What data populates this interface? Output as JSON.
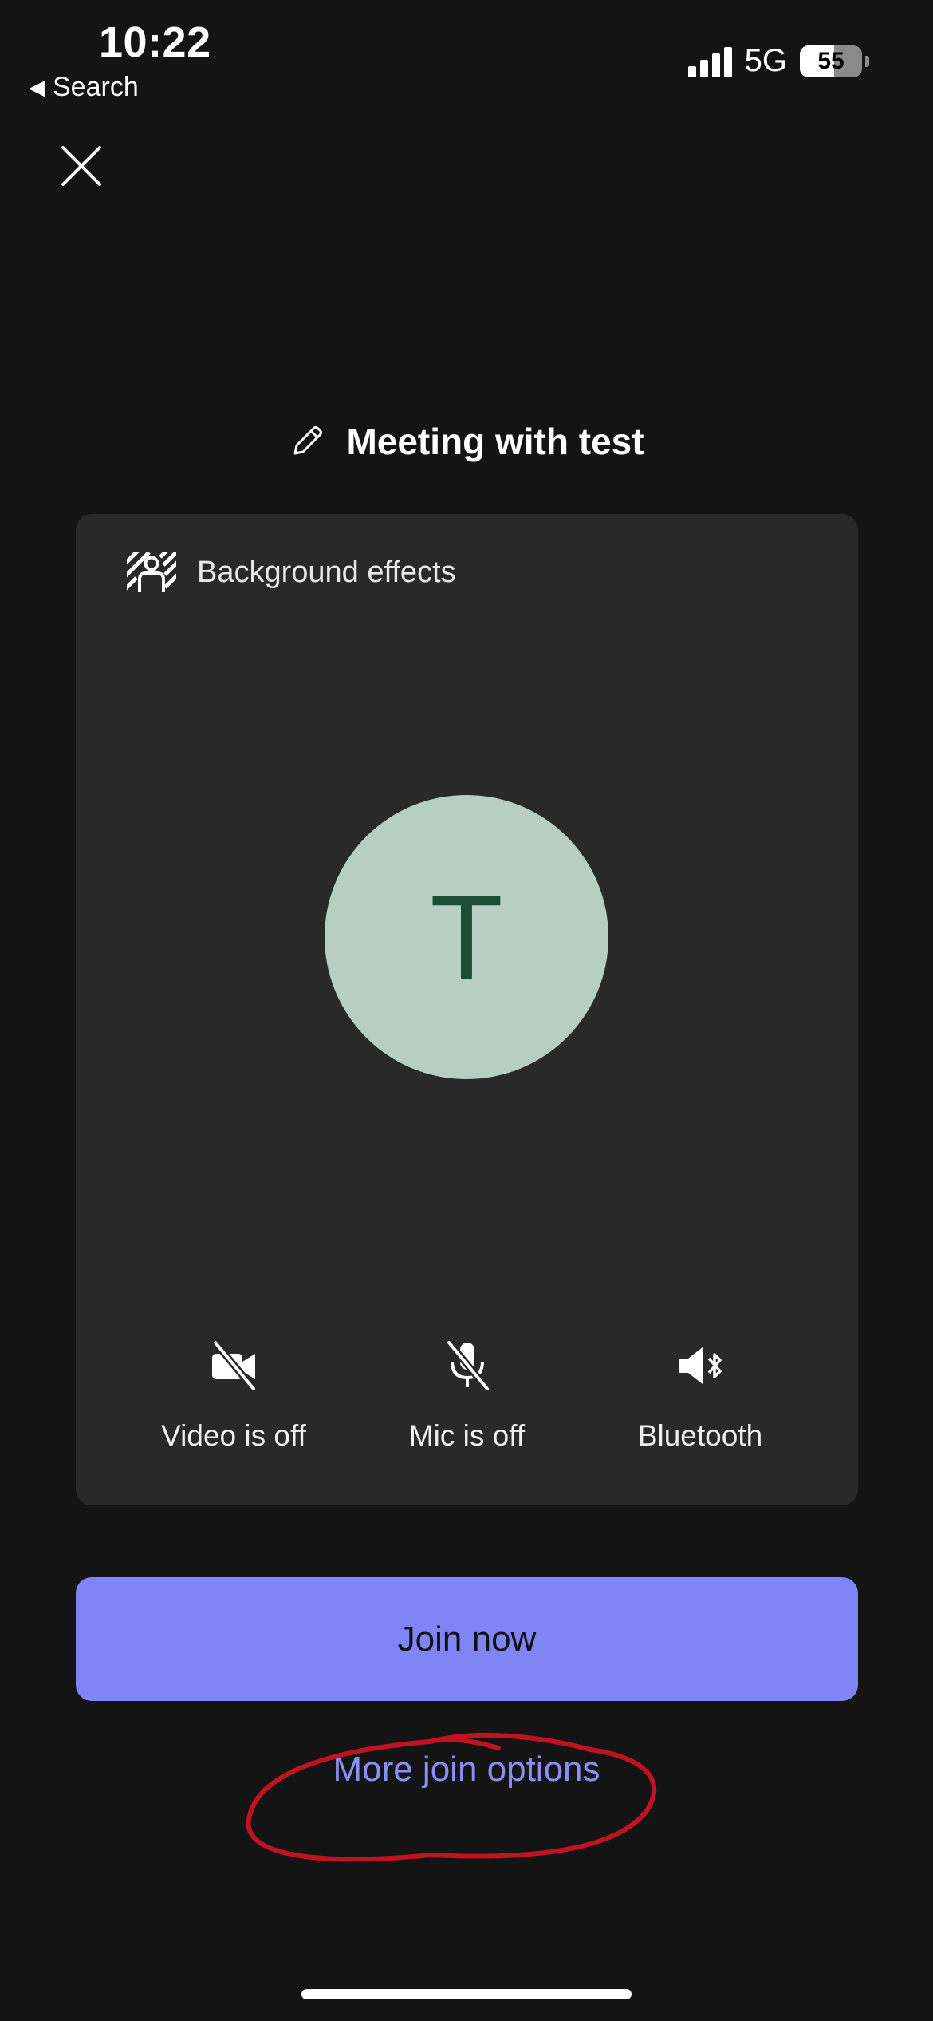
{
  "status_bar": {
    "time": "10:22",
    "back_label": "Search",
    "network": "5G",
    "battery_percent": "55",
    "battery_level": 0.55
  },
  "meeting": {
    "title": "Meeting with test"
  },
  "preview": {
    "background_effects_label": "Background effects",
    "avatar_initial": "T",
    "avatar_color": "#b7cfc3",
    "avatar_text_color": "#1e4d35",
    "controls": [
      {
        "icon": "video-off-icon",
        "label": "Video is off"
      },
      {
        "icon": "mic-off-icon",
        "label": "Mic is off"
      },
      {
        "icon": "speaker-bluetooth-icon",
        "label": "Bluetooth"
      }
    ]
  },
  "actions": {
    "join_label": "Join now",
    "more_options_label": "More join options",
    "accent_color": "#7f85f5",
    "annotation_color": "#c0121f"
  }
}
